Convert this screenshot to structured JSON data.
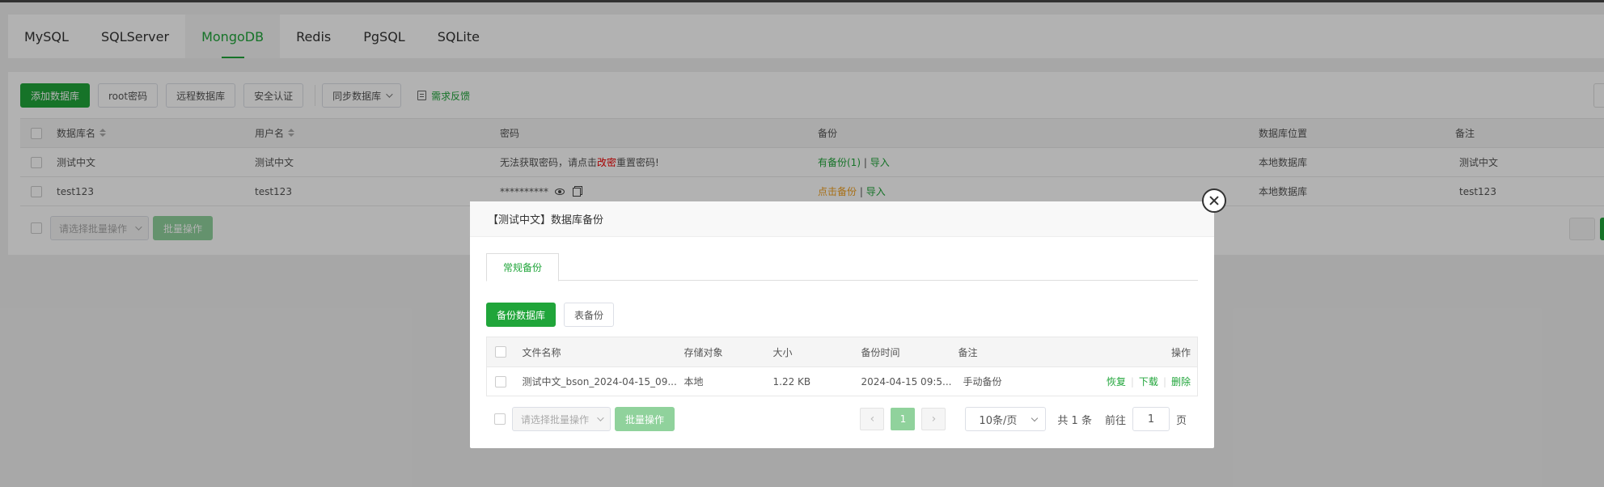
{
  "tabs": [
    "MySQL",
    "SQLServer",
    "MongoDB",
    "Redis",
    "PgSQL",
    "SQLite"
  ],
  "toolbar": {
    "add_db": "添加数据库",
    "root_pwd": "root密码",
    "remote_db": "远程数据库",
    "security_auth": "安全认证",
    "sync_db": "同步数据库",
    "feedback": "需求反馈"
  },
  "table": {
    "headers": {
      "name": "数据库名",
      "user": "用户名",
      "password": "密码",
      "backup": "备份",
      "location": "数据库位置",
      "remark": "备注"
    },
    "rows": [
      {
        "name": "测试中文",
        "user": "测试中文",
        "password_pre": "无法获取密码，请点击",
        "password_link": "改密",
        "password_post": "重置密码!",
        "backup": "有备份(1)",
        "import": "导入",
        "location": "本地数据库",
        "remark": "测试中文"
      },
      {
        "name": "test123",
        "user": "test123",
        "password_masked": "**********",
        "backup": "点击备份",
        "import": "导入",
        "location": "本地数据库",
        "remark": "test123"
      }
    ],
    "sep": "|"
  },
  "batch": {
    "placeholder": "请选择批量操作",
    "button": "批量操作"
  },
  "modal": {
    "title": "【测试中文】数据库备份",
    "tab": "常规备份",
    "backup_db_btn": "备份数据库",
    "table_backup_btn": "表备份",
    "headers": {
      "filename": "文件名称",
      "storage": "存储对象",
      "size": "大小",
      "time": "备份时间",
      "remark": "备注",
      "ops": "操作"
    },
    "rows": [
      {
        "filename": "测试中文_bson_2024-04-15_09...",
        "storage": "本地",
        "size": "1.22 KB",
        "time": "2024-04-15 09:5...",
        "remark": "手动备份",
        "ops": [
          "恢复",
          "下载",
          "删除"
        ]
      }
    ],
    "batch_placeholder": "请选择批量操作",
    "batch_button": "批量操作",
    "pager": {
      "prev": "‹",
      "current": "1",
      "next": "›",
      "page_size": "10条/页",
      "total": "共 1 条",
      "goto_prefix": "前往",
      "goto_value": "1",
      "goto_suffix": "页"
    }
  }
}
